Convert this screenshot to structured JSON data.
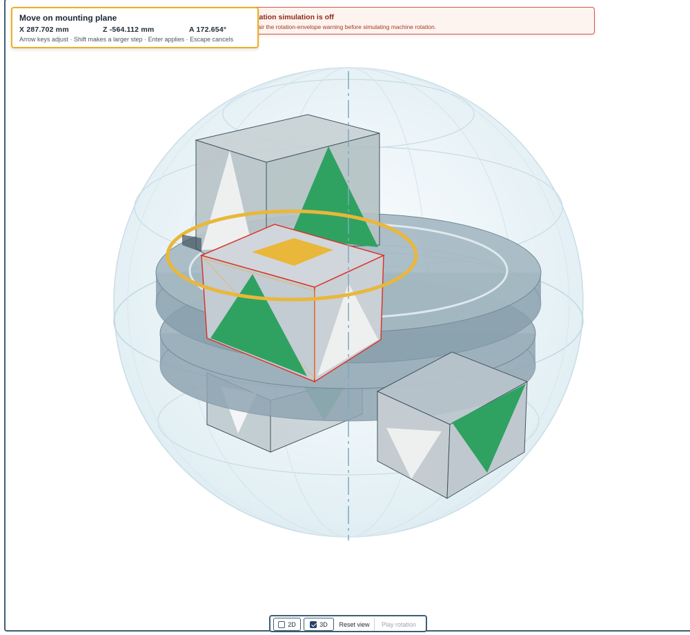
{
  "move_panel": {
    "title": "Move on mounting plane",
    "x": "X 287.702 mm",
    "z": "Z -564.112 mm",
    "a": "A 172.654°",
    "hint": "Arrow keys adjust · Shift makes a larger step · Enter applies · Escape cancels"
  },
  "warning": {
    "title": "Rotation simulation is off",
    "body": "Repair the rotation-envelope warning before simulating machine rotation."
  },
  "toolbar": {
    "view_2d_label": "2D",
    "view_2d_checked": false,
    "view_3d_label": "3D",
    "view_3d_checked": true,
    "reset_label": "Reset view",
    "play_label": "Play rotation",
    "play_enabled": false
  },
  "colors": {
    "frame_border": "#3d5d73",
    "accent_selection": "#e9b73a",
    "selection_outline": "#d9362b",
    "warning_border": "#d9553c",
    "panel_border": "#f0ad1c",
    "triangle_green": "#2fa262",
    "cube_grey": "#c3cbd1",
    "turntable": "#8ea5b1"
  }
}
